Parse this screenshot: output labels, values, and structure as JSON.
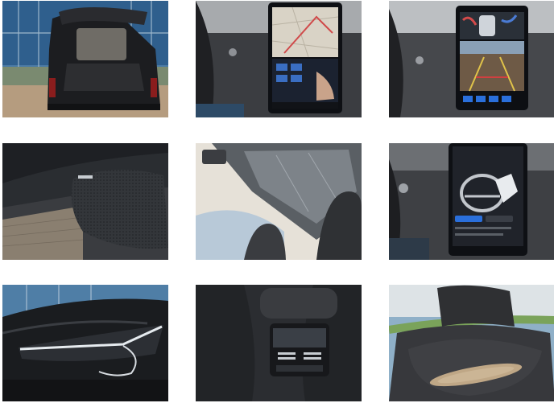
{
  "gallery": {
    "photos": [
      {
        "subject": "open-trunk",
        "brand_colors": {
          "glass": "#3c6e99",
          "body": "#1c1d20",
          "paving": "#b59c7f"
        }
      },
      {
        "subject": "center-touchscreen-map",
        "brand_colors": {
          "screen": "#1b2230",
          "map": "#d9d3c6"
        }
      },
      {
        "subject": "center-touchscreen-camera",
        "brand_colors": {
          "screen": "#141820",
          "ground": "#6e5a46"
        }
      },
      {
        "subject": "door-speaker-grille",
        "brand_colors": {
          "trim": "#2a2d31",
          "wood": "#8a7f70"
        }
      },
      {
        "subject": "panoramic-glass-roof",
        "brand_colors": {
          "headliner": "#e6e1d8",
          "glass": "#5a5f64"
        }
      },
      {
        "subject": "center-touchscreen-steering-settings",
        "brand_colors": {
          "screen": "#20232a",
          "accent": "#2a6fdb"
        }
      },
      {
        "subject": "headlight-front",
        "brand_colors": {
          "body": "#1a1c1f",
          "light": "#e6ebef"
        }
      },
      {
        "subject": "rear-console-vents",
        "brand_colors": {
          "leather": "#2b2d31",
          "chrome": "#c7ccd1"
        }
      },
      {
        "subject": "headrest-wood-inlay",
        "brand_colors": {
          "leather": "#2f3033",
          "wood": "#bfa786"
        }
      }
    ]
  }
}
